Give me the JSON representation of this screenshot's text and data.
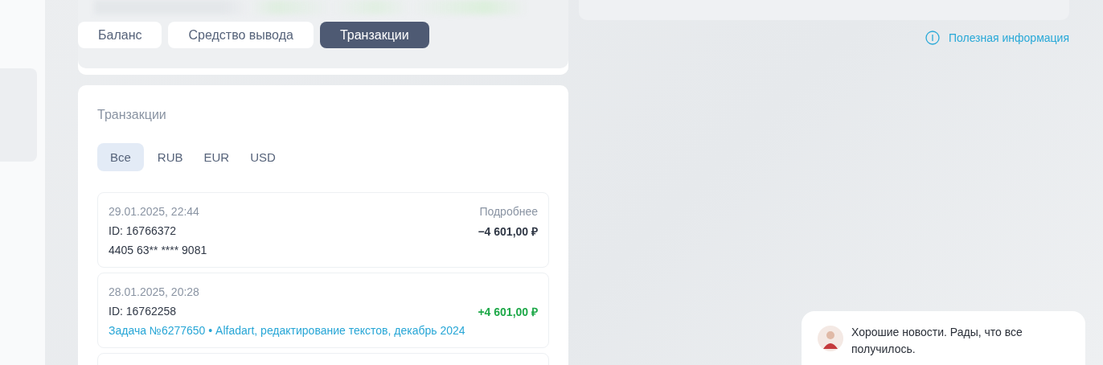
{
  "tabs": [
    {
      "label": "Баланс",
      "selected": false
    },
    {
      "label": "Средство вывода",
      "selected": false
    },
    {
      "label": "Транзакции",
      "selected": true
    }
  ],
  "info_link": {
    "label": "Полезная информация"
  },
  "transactions": {
    "title": "Транзакции",
    "filters": [
      {
        "label": "Все",
        "selected": true
      },
      {
        "label": "RUB",
        "selected": false
      },
      {
        "label": "EUR",
        "selected": false
      },
      {
        "label": "USD",
        "selected": false
      }
    ],
    "items": [
      {
        "date": "29.01.2025, 22:44",
        "details": "Подробнее",
        "id": "ID: 16766372",
        "amount": "−4 601,00 ₽",
        "kind": "debit",
        "description": "4405 63** **** 9081"
      },
      {
        "date": "28.01.2025, 20:28",
        "id": "ID: 16762258",
        "amount": "+4 601,00 ₽",
        "kind": "credit",
        "description": "Задача №6277650 • Alfadart, редактирование текстов, декабрь 2024"
      }
    ]
  },
  "notification": {
    "text": "Хорошие новости. Рады, что все получилось."
  }
}
